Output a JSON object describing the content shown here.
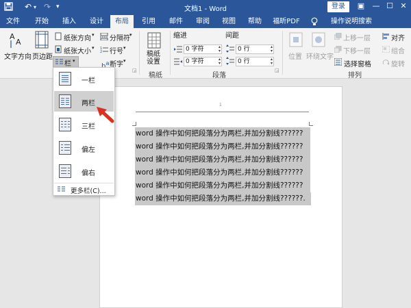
{
  "window": {
    "title": "文档1 - Word",
    "login": "登录"
  },
  "tabs": [
    "文件",
    "开始",
    "插入",
    "设计",
    "布局",
    "引用",
    "邮件",
    "审阅",
    "视图",
    "帮助",
    "福昕PDF",
    "操作说明搜索"
  ],
  "ribbon": {
    "page_setup": {
      "text_direction": "文字方向",
      "margins": "页边距",
      "orientation": "纸张方向",
      "size": "纸张大小",
      "columns": "栏",
      "breaks": "分隔符",
      "line_numbers": "行号",
      "hyphenation": "断字"
    },
    "draft": {
      "settings": "稿纸\n设置",
      "label": "稿纸"
    },
    "paragraph": {
      "indent": "缩进",
      "spacing": "间距",
      "indent_left": "0 字符",
      "indent_right": "0 字符",
      "space_before": "0 行",
      "space_after": "0 行",
      "label": "段落"
    },
    "arrange": {
      "position": "位置",
      "wrap_text": "环绕文字",
      "bring_forward": "上移一层",
      "send_backward": "下移一层",
      "selection_pane": "选择窗格",
      "align": "对齐",
      "group": "组合",
      "rotate": "旋转",
      "label": "排列"
    }
  },
  "columns_menu": {
    "items": [
      "一栏",
      "两栏",
      "三栏",
      "偏左",
      "偏右"
    ],
    "more": "更多栏(C)...",
    "highlighted": "两栏"
  },
  "document": {
    "page_number": "1",
    "lines": [
      "word 操作中如何把段落分为两栏,并加分割线??????",
      "word 操作中如何把段落分为两栏,并加分割线??????",
      "word 操作中如何把段落分为两栏,并加分割线??????",
      "word 操作中如何把段落分为两栏,并加分割线??????",
      "word 操作中如何把段落分为两栏,并加分割线??????",
      "word 操作中如何把段落分为两栏,并加分割线??????."
    ]
  },
  "colors": {
    "accent": "#2b579a",
    "arrow": "#d9321f"
  }
}
